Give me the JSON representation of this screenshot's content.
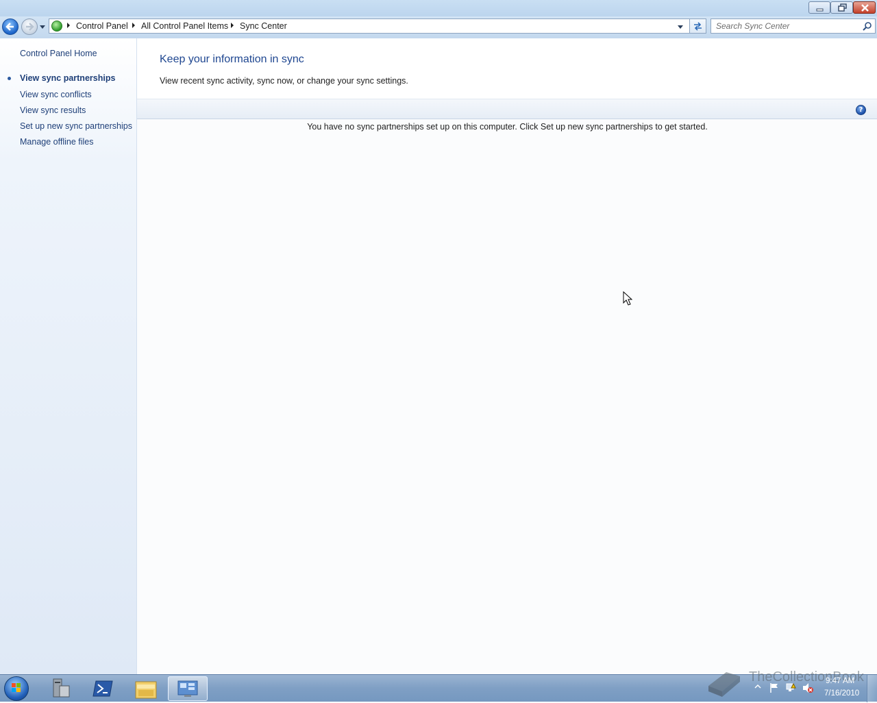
{
  "window": {
    "minimize_icon": "minimize-icon",
    "restore_icon": "restore-icon",
    "close_icon": "close-icon"
  },
  "address_bar": {
    "breadcrumbs": [
      "Control Panel",
      "All Control Panel Items",
      "Sync Center"
    ],
    "search_placeholder": "Search Sync Center"
  },
  "left_pane": {
    "home_link": "Control Panel Home",
    "current_task": "View sync partnerships",
    "links": [
      "View sync conflicts",
      "View sync results",
      "Set up new sync partnerships",
      "Manage offline files"
    ]
  },
  "main": {
    "heading": "Keep your information in sync",
    "subtext": "View recent sync activity, sync now, or change your sync settings.",
    "empty_message": "You have no sync partnerships set up on this computer. Click Set up new sync partnerships to get started.",
    "help_icon": "?"
  },
  "taskbar": {
    "clock_time": "9:47 AM",
    "clock_date": "7/16/2010",
    "watermark": "TheCollectionBook",
    "items": [
      "server-manager-icon",
      "powershell-icon",
      "explorer-icon",
      "control-panel-icon"
    ]
  },
  "colors": {
    "link": "#1e3f78",
    "heading": "#1e4690",
    "titlebar": "#c9dff3"
  }
}
